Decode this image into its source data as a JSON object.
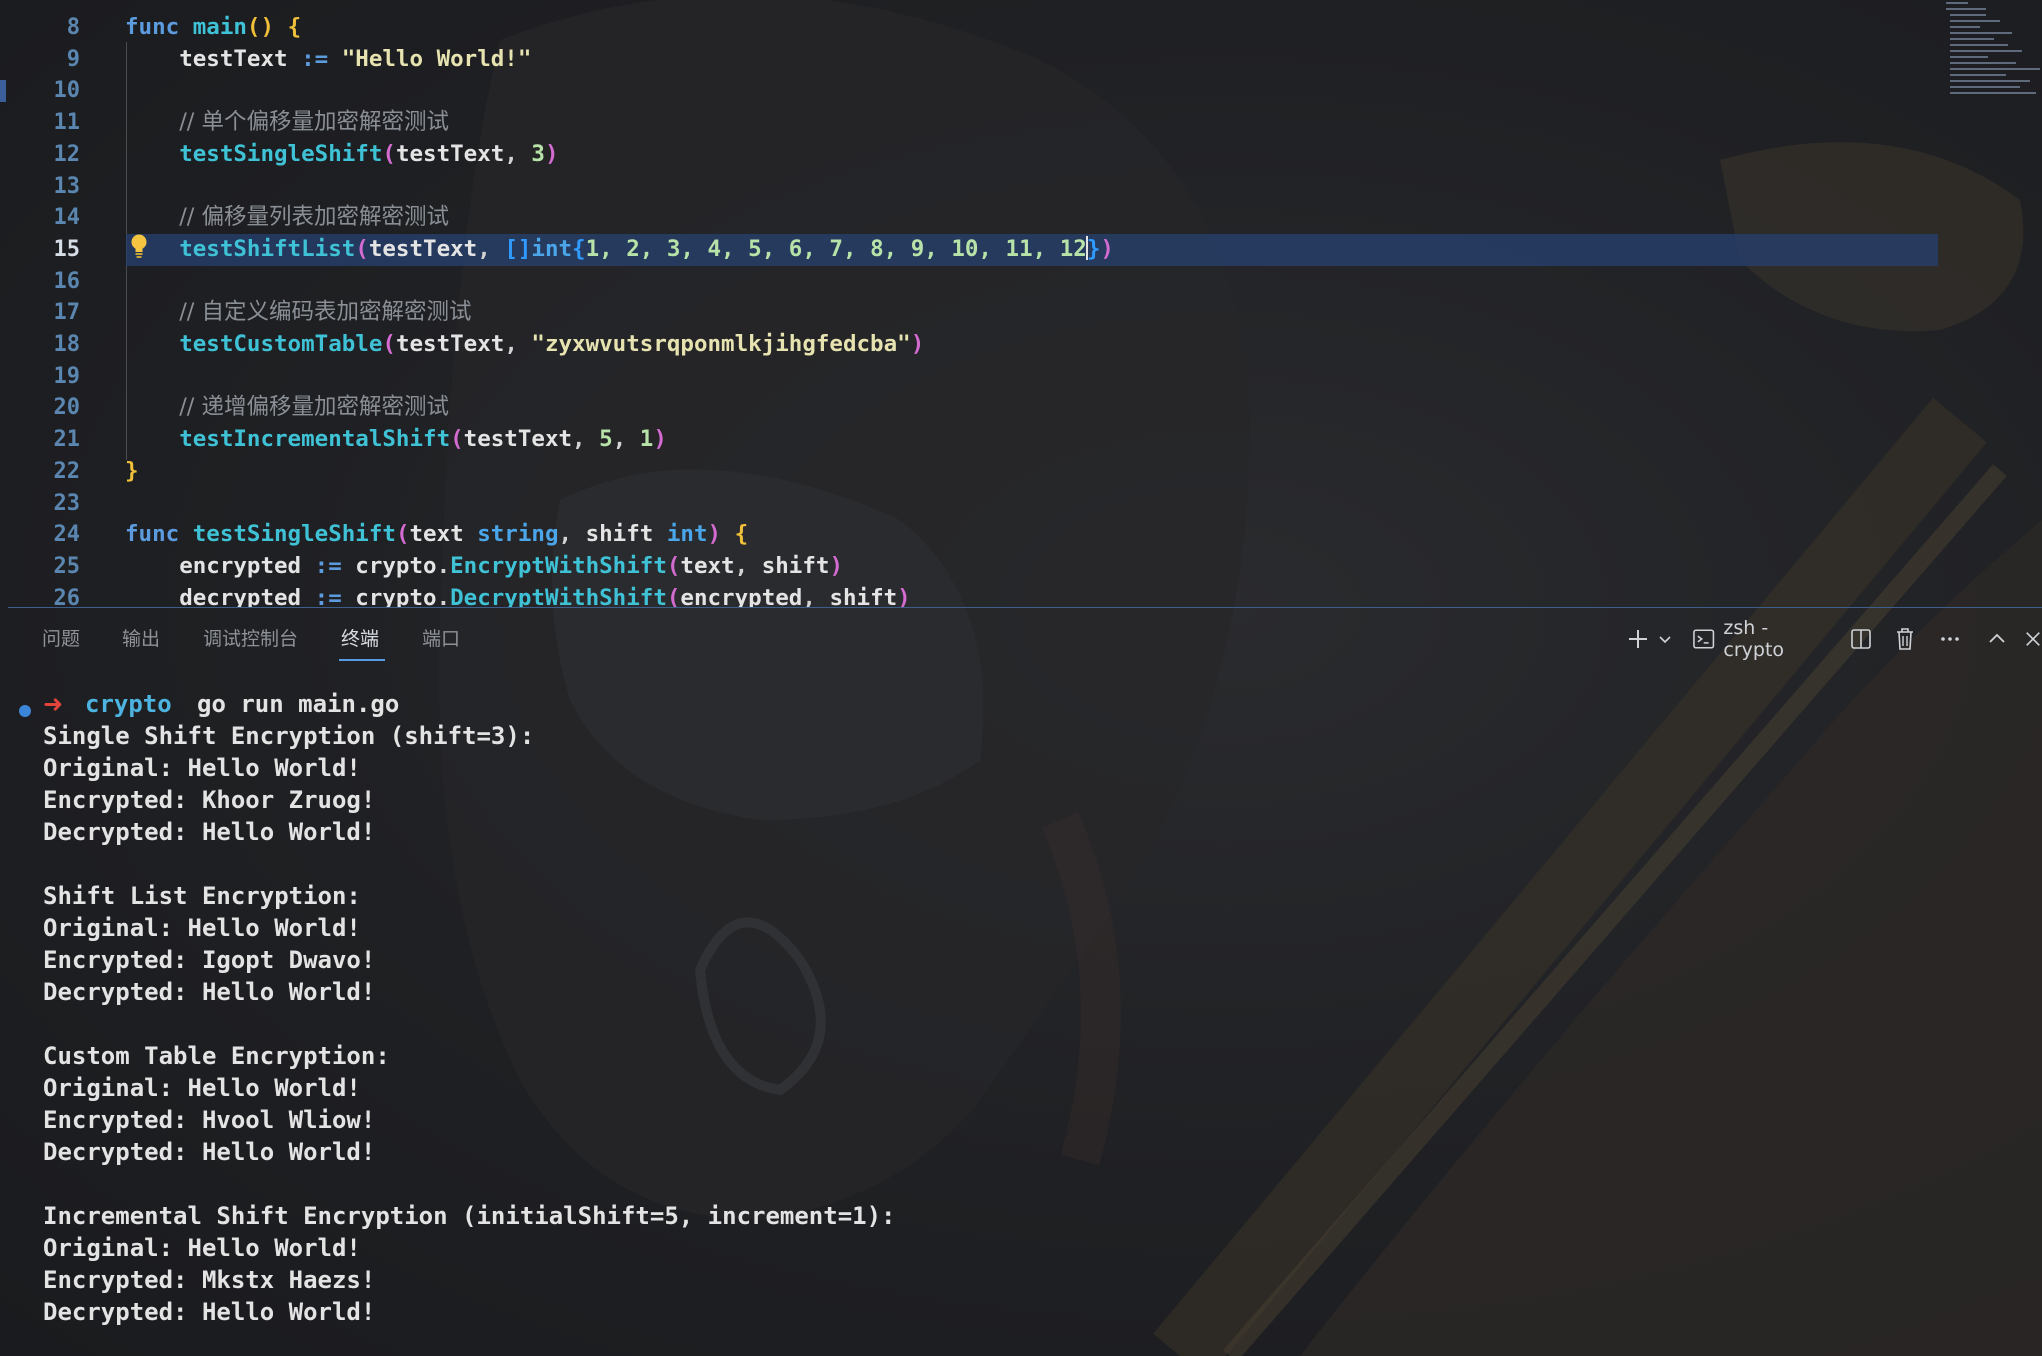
{
  "editor": {
    "lines": [
      {
        "num": "8"
      },
      {
        "num": "9"
      },
      {
        "num": "10"
      },
      {
        "num": "11"
      },
      {
        "num": ""
      },
      {
        "num": "12"
      },
      {
        "num": "13"
      },
      {
        "num": "14"
      },
      {
        "num": "15"
      },
      {
        "num": "16"
      },
      {
        "num": "17"
      },
      {
        "num": "18"
      },
      {
        "num": "19"
      },
      {
        "num": "20"
      },
      {
        "num": "21"
      },
      {
        "num": "22"
      },
      {
        "num": "23"
      },
      {
        "num": "24"
      },
      {
        "num": "25"
      },
      {
        "num": "26"
      }
    ],
    "comments": [
      "// 单个偏移量加密解密测试",
      "// 偏移量列表加密解密测试",
      "// 自定义编码表加密解密测试",
      "// 递增偏移量加密解密测试"
    ],
    "tok": {
      "func": "func",
      "main": "main",
      "testText": "testText",
      "helloWorldLit": "\"Hello World!\"",
      "testSingleShift": "testSingleShift",
      "testShiftList": "testShiftList",
      "shiftValues": "1, 2, 3, 4, 5, 6, 7, 8, 9, 10, 11, 12",
      "testCustomTable": "testCustomTable",
      "tableLit": "\"zyxwvutsrqponmlkjihgfedcba\"",
      "testIncrementalShift": "testIncrementalShift",
      "textParam": "text",
      "stringType": "string",
      "shiftParam": "shift",
      "intType": "int",
      "encrypted": "encrypted",
      "decrypted": "decrypted",
      "cryptoPkg": "crypto",
      "encryptWithShift": "EncryptWithShift",
      "decryptWithShift": "DecryptWithShift"
    }
  },
  "panel": {
    "tabs": [
      "问题",
      "输出",
      "调试控制台",
      "终端",
      "端口"
    ],
    "active_tab": "终端",
    "terminal_name": "zsh - crypto"
  },
  "terminal": {
    "prompt": {
      "arrow": "➜",
      "dir": "crypto",
      "command": "go run main.go"
    },
    "lines": [
      "Single Shift Encryption (shift=3):",
      "Original: Hello World!",
      "Encrypted: Khoor Zruog!",
      "Decrypted: Hello World!",
      "",
      "Shift List Encryption:",
      "Original: Hello World!",
      "Encrypted: Igopt Dwavo!",
      "Decrypted: Hello World!",
      "",
      "Custom Table Encryption:",
      "Original: Hello World!",
      "Encrypted: Hvool Wliow!",
      "Decrypted: Hello World!",
      "",
      "Incremental Shift Encryption (initialShift=5, increment=1):",
      "Original: Hello World!",
      "Encrypted: Mkstx Haezs!",
      "Decrypted: Hello World!"
    ]
  }
}
